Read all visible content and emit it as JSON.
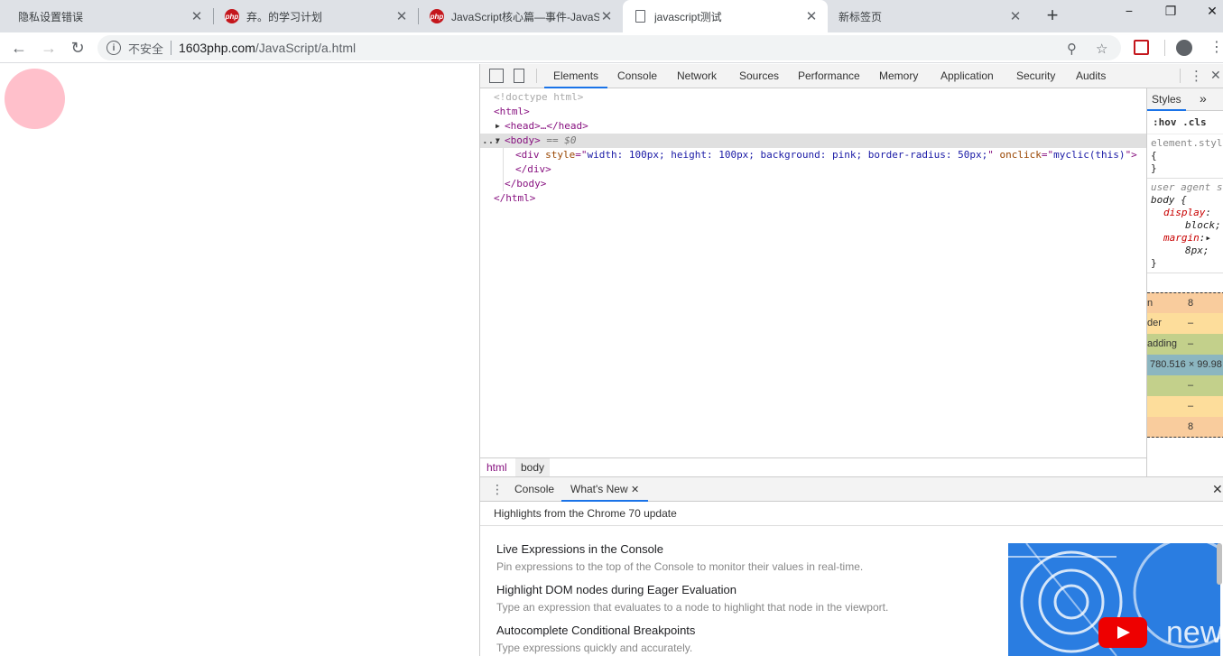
{
  "browser": {
    "tabs": [
      {
        "title": "隐私设置错误",
        "favicon": "none"
      },
      {
        "title": "弃。的学习计划",
        "favicon": "php-icon"
      },
      {
        "title": "JavaScript核心篇—事件-JavaScri",
        "favicon": "php-icon"
      },
      {
        "title": "javascript测试",
        "favicon": "page-icon",
        "active": true
      },
      {
        "title": "新标签页",
        "favicon": "none"
      }
    ],
    "new_tab": "+",
    "window_controls": {
      "minimize": "−",
      "maximize": "❐",
      "close": "✕"
    },
    "nav": {
      "back": "←",
      "forward": "→",
      "reload": "↻"
    },
    "omnibox": {
      "security_label": "不安全",
      "domain": "1603php.com",
      "path": "/JavaScript/a.html"
    }
  },
  "page": {
    "circle_color": "#ffc0cb"
  },
  "devtools": {
    "tabs": [
      "Elements",
      "Console",
      "Network",
      "Sources",
      "Performance",
      "Memory",
      "Application",
      "Security",
      "Audits"
    ],
    "active_tab": "Elements",
    "dom": {
      "doctype": "<!doctype html>",
      "html_open": "<html>",
      "head": "<head>…</head>",
      "body_open": "<body>",
      "body_marker": " == $0",
      "div_tag": "div",
      "div_attr1_name": "style",
      "div_attr1_value": "width: 100px; height: 100px; background: pink; border-radius: 50px;",
      "div_attr2_name": "onclick",
      "div_attr2_value": "myclic(this)",
      "div_close": "</div>",
      "body_close": "</body>",
      "html_close": "</html>",
      "ellipsis": "..."
    },
    "breadcrumbs": [
      "html",
      "body"
    ],
    "styles": {
      "tab": "Styles",
      "more": "»",
      "filter": ":hov .cls",
      "element_style_selector": "element.style",
      "element_style_open": "{",
      "close_brace": "}",
      "ua_label": "user agent s",
      "ua_selector": "body {",
      "prop1": "display",
      "val1": "block;",
      "prop2": "margin",
      "val2": "8px;",
      "box_model": {
        "margin_label": "n",
        "margin_top": "8",
        "border_label": "der",
        "border_value": "–",
        "padding_label": "adding",
        "padding_value": "–",
        "content_size": "780.516 × 99.98",
        "padding_bottom": "–",
        "border_bottom": "–",
        "margin_bottom": "8"
      }
    },
    "drawer": {
      "tabs": [
        "Console",
        "What's New"
      ],
      "active": "What's New",
      "close": "✕",
      "subtitle": "Highlights from the Chrome 70 update",
      "items": [
        {
          "title": "Live Expressions in the Console",
          "desc": "Pin expressions to the top of the Console to monitor their values in real-time."
        },
        {
          "title": "Highlight DOM nodes during Eager Evaluation",
          "desc": "Type an expression that evaluates to a node to highlight that node in the viewport."
        },
        {
          "title": "Autocomplete Conditional Breakpoints",
          "desc": "Type expressions quickly and accurately."
        }
      ],
      "thumb_text": "new"
    }
  },
  "colors": {
    "accent": "#1a73e8",
    "tag": "#881280",
    "attr": "#994500",
    "value": "#1a1aa6"
  }
}
